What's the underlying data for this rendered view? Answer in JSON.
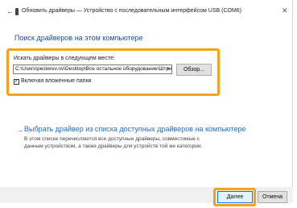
{
  "window": {
    "title": "Обновить драйверы — Устройство с последовательным интерфейсом USB (COM6)",
    "back_glyph": "←",
    "close_glyph": "✕"
  },
  "page": {
    "heading": "Поиск драйверов на этом компьютере"
  },
  "search": {
    "label": "Искать драйверы в следующем месте:",
    "path_value": "C:\\Users\\pesterev.ov\\Desktop\\Все остальное оборудование\\Штрих",
    "browse_label": "Обзор...",
    "include_subfolders_label": "Включая вложенные папки",
    "include_subfolders_checked": true,
    "check_glyph": "✓"
  },
  "pick_option": {
    "arrow_glyph": "→",
    "link_text": "Выбрать драйвер из списка доступных драйверов на компьютере",
    "description": "В этом списке перечисляются все доступные драйверы, совместимые с данным устройством, а также драйверы для устройств той же категории."
  },
  "footer": {
    "next_label": "Далее",
    "cancel_label": "Отмена"
  },
  "colors": {
    "accent": "#1a4ea0",
    "link": "#1a6fbf",
    "highlight": "#f2a31b"
  }
}
